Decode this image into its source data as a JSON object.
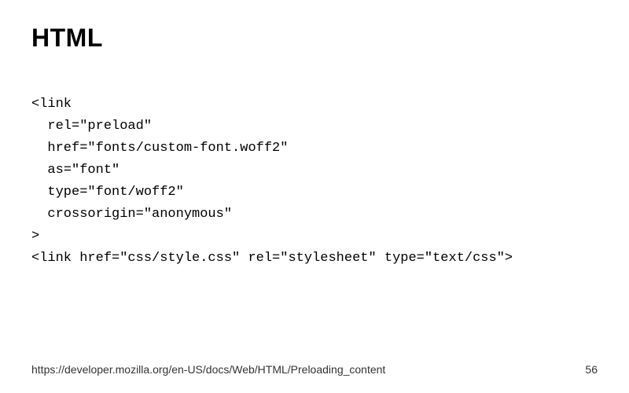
{
  "title": "HTML",
  "code": "<link\n  rel=\"preload\"\n  href=\"fonts/custom-font.woff2\"\n  as=\"font\"\n  type=\"font/woff2\"\n  crossorigin=\"anonymous\"\n>\n<link href=\"css/style.css\" rel=\"stylesheet\" type=\"text/css\">",
  "footer": {
    "url": "https://developer.mozilla.org/en-US/docs/Web/HTML/Preloading_content",
    "page": "56"
  }
}
